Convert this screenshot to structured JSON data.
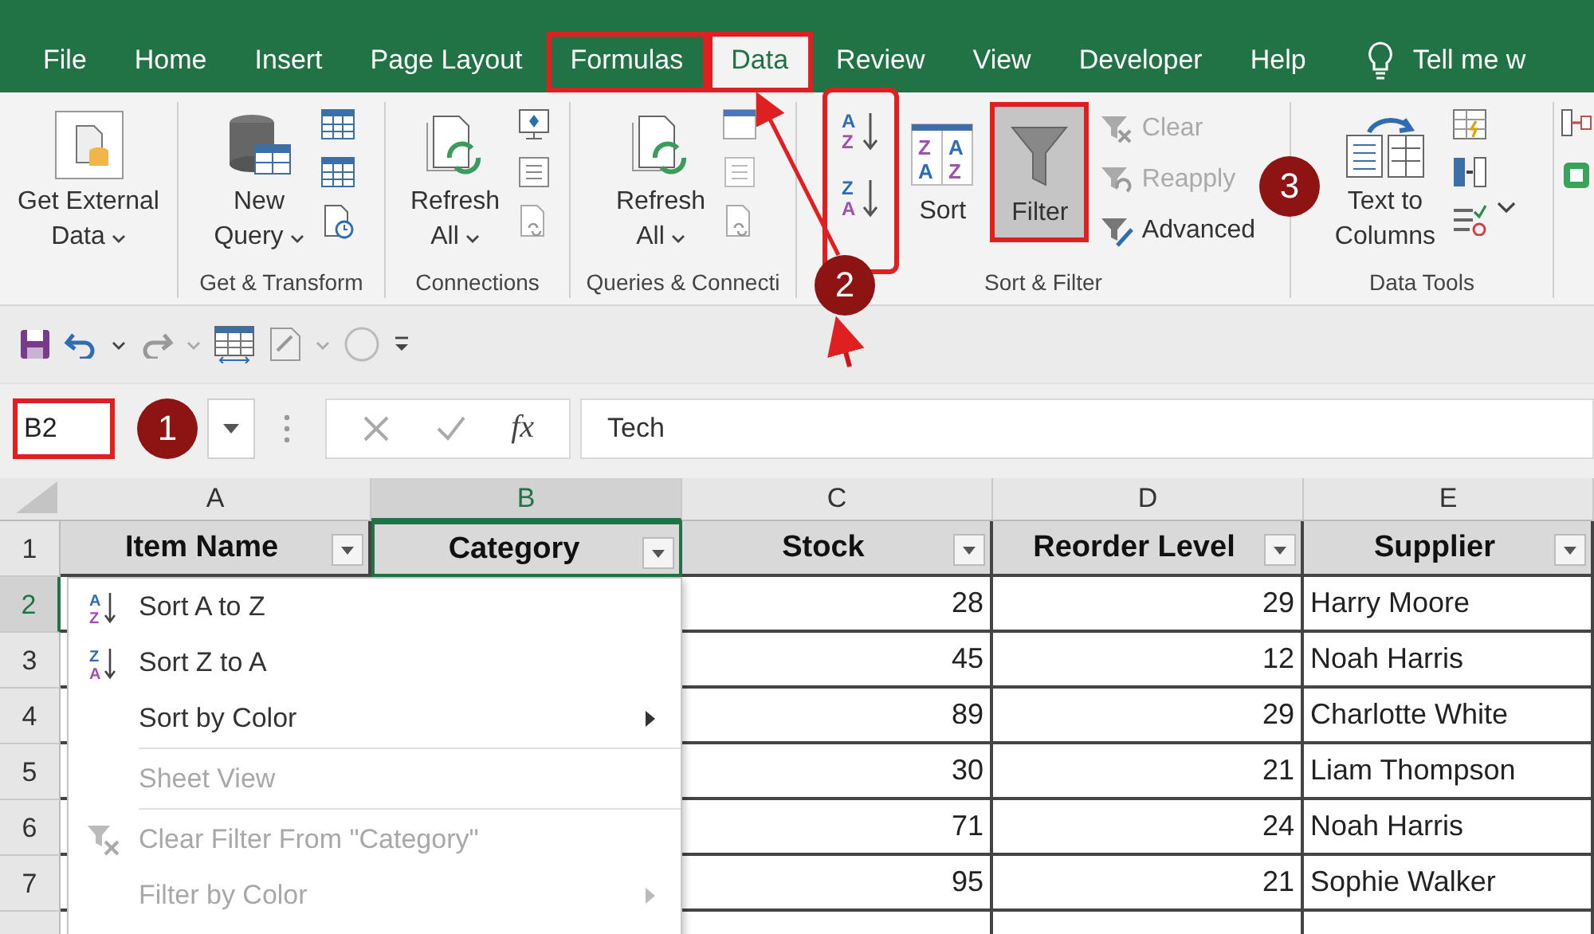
{
  "tabs": [
    {
      "label": "File",
      "selected": false,
      "callout": false
    },
    {
      "label": "Home",
      "selected": false,
      "callout": false
    },
    {
      "label": "Insert",
      "selected": false,
      "callout": false
    },
    {
      "label": "Page Layout",
      "selected": false,
      "callout": false
    },
    {
      "label": "Formulas",
      "selected": false,
      "callout": true
    },
    {
      "label": "Data",
      "selected": true,
      "callout": true
    },
    {
      "label": "Review",
      "selected": false,
      "callout": false
    },
    {
      "label": "View",
      "selected": false,
      "callout": false
    },
    {
      "label": "Developer",
      "selected": false,
      "callout": false
    },
    {
      "label": "Help",
      "selected": false,
      "callout": false
    }
  ],
  "tell_me": "Tell me w",
  "ribbon": {
    "get_external_data": {
      "lines": [
        "Get External",
        "Data"
      ],
      "caret": true
    },
    "groups": [
      {
        "kind": "get-transform",
        "label": "Get & Transform",
        "buttons": [
          {
            "lines": [
              "New",
              "Query"
            ],
            "caret": true
          }
        ]
      },
      {
        "kind": "connections",
        "label": "Connections",
        "buttons": [
          {
            "lines": [
              "Refresh",
              "All"
            ],
            "caret": true
          }
        ]
      },
      {
        "kind": "queries",
        "label": "Queries & Connecti",
        "buttons": [
          {
            "lines": [
              "Refresh",
              "All"
            ],
            "caret": true
          }
        ]
      },
      {
        "kind": "sort-filter",
        "label": "Sort & Filter",
        "quick_sort_callout": true,
        "quick_sort": [
          {
            "letters": [
              "A",
              "Z"
            ]
          },
          {
            "letters": [
              "Z",
              "A"
            ]
          }
        ],
        "buttons": [
          {
            "lines": [
              "Sort"
            ],
            "letters": [
              "Z",
              "A",
              "A",
              "Z"
            ],
            "pressed": false,
            "callout": false
          },
          {
            "lines": [
              "Filter"
            ],
            "pressed": true,
            "callout": true
          }
        ],
        "small": [
          {
            "label": "Clear",
            "disabled": true
          },
          {
            "label": "Reapply",
            "disabled": true
          },
          {
            "label": "Advanced",
            "disabled": false
          }
        ]
      },
      {
        "kind": "data-tools",
        "label": "Data Tools",
        "buttons": [
          {
            "lines": [
              "Text to",
              "Columns"
            ],
            "caret": false
          }
        ]
      }
    ]
  },
  "name_box": {
    "value": "B2",
    "callout": true
  },
  "formula_symbol": "fx",
  "formula": "Tech",
  "columns": [
    {
      "letter": "A",
      "selected": false
    },
    {
      "letter": "B",
      "selected": true
    },
    {
      "letter": "C",
      "selected": false
    },
    {
      "letter": "D",
      "selected": false
    },
    {
      "letter": "E",
      "selected": false
    }
  ],
  "header_row": {
    "number": "1",
    "selected": false,
    "cells": [
      "Item Name",
      "Category",
      "Stock",
      "Reorder Level",
      "Supplier"
    ]
  },
  "data_rows": [
    {
      "number": "2",
      "selected": true,
      "cells": [
        "28",
        "29",
        "Harry Moore"
      ]
    },
    {
      "number": "3",
      "selected": false,
      "cells": [
        "45",
        "12",
        "Noah Harris"
      ]
    },
    {
      "number": "4",
      "selected": false,
      "cells": [
        "89",
        "29",
        "Charlotte White"
      ]
    },
    {
      "number": "5",
      "selected": false,
      "cells": [
        "30",
        "21",
        "Liam Thompson"
      ]
    },
    {
      "number": "6",
      "selected": false,
      "cells": [
        "71",
        "24",
        "Noah Harris"
      ]
    },
    {
      "number": "7",
      "selected": false,
      "cells": [
        "95",
        "21",
        "Sophie Walker"
      ]
    }
  ],
  "filter_menu": {
    "items": [
      {
        "kind": "sort-asc",
        "letters": [
          "A",
          "Z"
        ],
        "label": "Sort A to Z",
        "disabled": false,
        "submenu": false
      },
      {
        "kind": "sort-desc",
        "letters": [
          "Z",
          "A"
        ],
        "label": "Sort Z to A",
        "disabled": false,
        "submenu": false
      },
      {
        "kind": "plain",
        "label": "Sort by Color",
        "disabled": false,
        "submenu": true
      },
      {
        "kind": "separator"
      },
      {
        "kind": "plain",
        "label": "Sheet View",
        "disabled": true,
        "submenu": false
      },
      {
        "kind": "separator"
      },
      {
        "kind": "clear-filter",
        "label": "Clear Filter From \"Category\"",
        "disabled": true,
        "submenu": false
      },
      {
        "kind": "plain",
        "label": "Filter by Color",
        "disabled": true,
        "submenu": true
      }
    ]
  },
  "markers": [
    "1",
    "2",
    "3"
  ]
}
